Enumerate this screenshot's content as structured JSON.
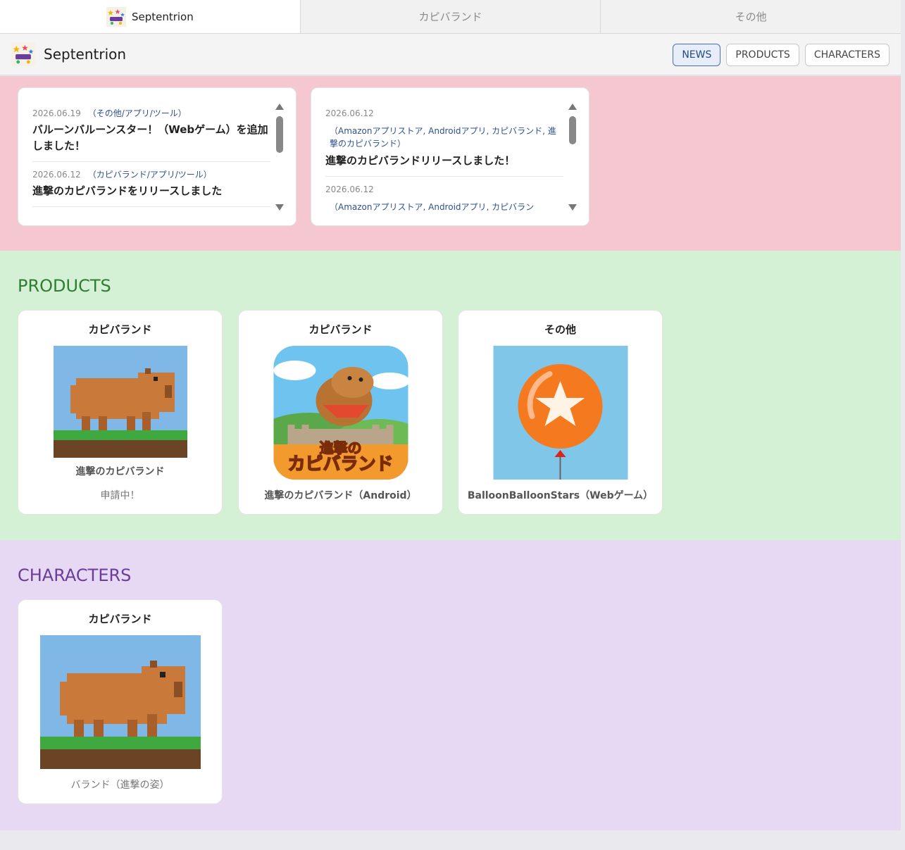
{
  "tabs": [
    {
      "label": "Septentrion"
    },
    {
      "label": "カピバランド"
    },
    {
      "label": "その他"
    }
  ],
  "header": {
    "brand": "Septentrion",
    "nav": [
      "NEWS",
      "PRODUCTS",
      "CHARACTERS"
    ]
  },
  "news": {
    "col1": [
      {
        "date": "2026.06.19",
        "category": "（その他/アプリ/ツール）",
        "title": "バルーンバルーンスター！（Webゲーム）を追加しました！"
      },
      {
        "date": "2026.06.12",
        "category": "（カピバランド/アプリ/ツール）",
        "title": "進撃のカピバランドをリリースしました"
      }
    ],
    "col2": [
      {
        "date": "2026.06.12",
        "category": "（Amazonアプリストア, Androidアプリ, カピバランド, 進撃のカピバランド）",
        "title": "進撃のカピバランドリリースしました！"
      },
      {
        "date": "2026.06.12",
        "category": "（Amazonアプリストア, Androidアプリ, カピバラン"
      }
    ]
  },
  "products": {
    "title": "PRODUCTS",
    "cards": [
      {
        "category": "カピバランド",
        "name": "進撃のカピバランド",
        "status": "申請中！"
      },
      {
        "category": "カピバランド",
        "name": "進撃のカピバランド（Android）",
        "logo_line1": "進撃の",
        "logo_line2": "カピバランド"
      },
      {
        "category": "その他",
        "name": "BalloonBalloonStars（Webゲーム）"
      }
    ]
  },
  "characters": {
    "title": "CHARACTERS",
    "cards": [
      {
        "category": "カピバランド",
        "name": "バランド（進撃の姿）"
      }
    ]
  },
  "colors": {
    "news_bg": "#f5c7d0",
    "products_bg": "#d5f1d5",
    "characters_bg": "#e7d8f4",
    "products_title": "#2e7d32",
    "characters_title": "#6a3d9a",
    "link_blue": "#2f4f8f"
  }
}
